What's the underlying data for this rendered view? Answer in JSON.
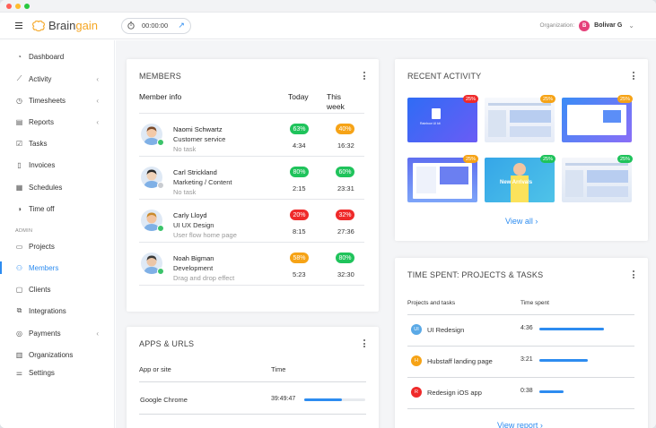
{
  "window": {
    "dots": [
      "#ff5f57",
      "#febc2e",
      "#28c840"
    ]
  },
  "topbar": {
    "brand_part1": "Brain",
    "brand_part2": "gain",
    "timer_value": "00:00:00",
    "org_label": "Organization:",
    "org_avatar_letter": "B",
    "org_user": "Bolivar G"
  },
  "sidebar": {
    "admin_label": "ADMIN",
    "items": [
      {
        "label": "Dashboard",
        "icon": "dashboard-icon",
        "chevron": false
      },
      {
        "label": "Activity",
        "icon": "activity-icon",
        "chevron": true
      },
      {
        "label": "Timesheets",
        "icon": "clock-icon",
        "chevron": true
      },
      {
        "label": "Reports",
        "icon": "reports-icon",
        "chevron": true
      },
      {
        "label": "Tasks",
        "icon": "tasks-icon",
        "chevron": false
      },
      {
        "label": "Invoices",
        "icon": "invoice-icon",
        "chevron": false
      },
      {
        "label": "Schedules",
        "icon": "calendar-icon",
        "chevron": false
      },
      {
        "label": "Time off",
        "icon": "time-off-icon",
        "chevron": false
      },
      {
        "label": "Projects",
        "icon": "folder-icon",
        "chevron": false
      },
      {
        "label": "Members",
        "icon": "members-icon",
        "chevron": false,
        "active": true
      },
      {
        "label": "Clients",
        "icon": "clients-icon",
        "chevron": false
      },
      {
        "label": "Integrations",
        "icon": "integrations-icon",
        "chevron": false
      },
      {
        "label": "Payments",
        "icon": "payments-icon",
        "chevron": true
      },
      {
        "label": "Organizations",
        "icon": "organizations-icon",
        "chevron": false
      },
      {
        "label": "Settings",
        "icon": "settings-icon",
        "chevron": false
      }
    ]
  },
  "members": {
    "title": "MEMBERS",
    "col_info": "Member info",
    "col_today": "Today",
    "col_week_1": "This",
    "col_week_2": "week",
    "rows": [
      {
        "name": "Naomi Schwartz",
        "role": "Customer service",
        "task": "No task",
        "today_pct": "63%",
        "today_color": "#1fc35b",
        "today_time": "4:34",
        "week_pct": "40%",
        "week_color": "#f6a316",
        "week_time": "16:32",
        "online": true
      },
      {
        "name": "Carl Strickland",
        "role": "Marketing / Content",
        "task": "No task",
        "today_pct": "80%",
        "today_color": "#1fc35b",
        "today_time": "2:15",
        "week_pct": "60%",
        "week_color": "#1fc35b",
        "week_time": "23:31",
        "online": false
      },
      {
        "name": "Carly Lloyd",
        "role": "UI UX Design",
        "task": "User flow home page",
        "today_pct": "20%",
        "today_color": "#ef2a2a",
        "today_time": "8:15",
        "week_pct": "32%",
        "week_color": "#ef2a2a",
        "week_time": "27:36",
        "online": true
      },
      {
        "name": "Noah Bigman",
        "role": "Development",
        "task": "Drag and drop effect",
        "today_pct": "58%",
        "today_color": "#f6a316",
        "today_time": "5:23",
        "week_pct": "80%",
        "week_color": "#1fc35b",
        "week_time": "32:30",
        "online": true
      }
    ]
  },
  "recent_activity": {
    "title": "RECENT ACTIVITY",
    "view_all": "View all",
    "thumb_caption_1": "Rainbow UI kit",
    "thumb_caption_5": "New Arrivals",
    "thumbs": [
      {
        "badge": "25%",
        "badge_color": "#ef2a2a"
      },
      {
        "badge": "25%",
        "badge_color": "#f6a316"
      },
      {
        "badge": "25%",
        "badge_color": "#f6a316"
      },
      {
        "badge": "25%",
        "badge_color": "#f6a316"
      },
      {
        "badge": "25%",
        "badge_color": "#1fc35b"
      },
      {
        "badge": "25%",
        "badge_color": "#1fc35b"
      }
    ]
  },
  "apps": {
    "title": "APPS & URLS",
    "col_app": "App or site",
    "col_time": "Time",
    "rows": [
      {
        "name": "Google Chrome",
        "time": "39:49:47",
        "progress": 0.62
      }
    ]
  },
  "time_spent": {
    "title": "TIME SPENT: PROJECTS & TASKS",
    "col_projects": "Projects and tasks",
    "col_time": "Time spent",
    "view_report": "View report",
    "rows": [
      {
        "initials": "UI",
        "color": "#5aa9e6",
        "name": "UI Redesign",
        "time": "4:36",
        "progress": 0.8
      },
      {
        "initials": "H",
        "color": "#f6a316",
        "name": "Hubstaff landing page",
        "time": "3:21",
        "progress": 0.6
      },
      {
        "initials": "R",
        "color": "#ef2a2a",
        "name": "Redesign iOS app",
        "time": "0:38",
        "progress": 0.3
      }
    ]
  }
}
